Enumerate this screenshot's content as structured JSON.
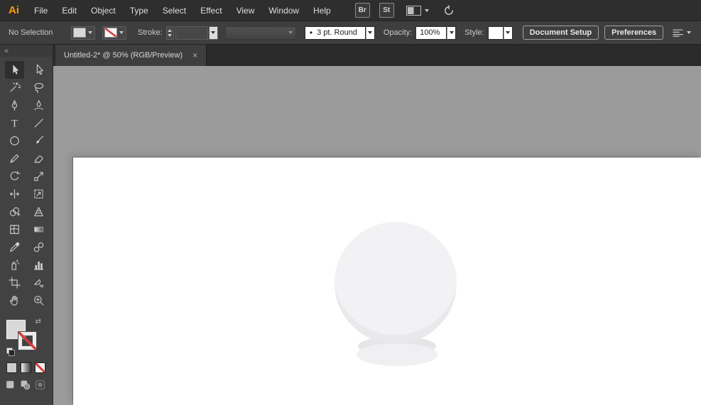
{
  "colors": {
    "none-red": "#d93a3a",
    "canvas": "#9b9b9b",
    "artboard": "#ffffff",
    "sphere": "#f2f2f4",
    "sphere-shade": "#e9e9ec",
    "base-top": "#e6e6e9",
    "base-bottom": "#f0f0f2",
    "logo-orange": "#ff9a00"
  },
  "menubar": {
    "logo": "Ai",
    "items": [
      "File",
      "Edit",
      "Object",
      "Type",
      "Select",
      "Effect",
      "View",
      "Window",
      "Help"
    ],
    "br_label": "Br",
    "st_label": "St"
  },
  "controlbar": {
    "selection_status": "No Selection",
    "stroke_label": "Stroke:",
    "brush_bullet": "•",
    "brush_name": "3 pt. Round",
    "opacity_label": "Opacity:",
    "opacity_value": "100%",
    "style_label": "Style:",
    "document_setup_label": "Document Setup",
    "preferences_label": "Preferences"
  },
  "tabbar": {
    "document_title": "Untitled-2* @ 50% (RGB/Preview)",
    "close_glyph": "×"
  },
  "document": {
    "name": "Untitled-2*",
    "zoom_percent": "50%",
    "color_mode": "RGB/Preview"
  },
  "toolbar": {
    "collapse_glyph": "«",
    "swap_glyph": "⇄",
    "active_tool": "selection",
    "tools": [
      "selection",
      "direct-selection",
      "magic-wand",
      "lasso",
      "pen",
      "curvature",
      "type",
      "line-segment",
      "ellipse",
      "paintbrush",
      "pencil",
      "eraser",
      "rotate",
      "scale",
      "width",
      "free-transform",
      "shape-builder",
      "perspective-grid",
      "mesh",
      "gradient",
      "eyedropper",
      "blend",
      "symbol-sprayer",
      "column-graph",
      "artboard",
      "slice",
      "hand",
      "zoom"
    ]
  }
}
